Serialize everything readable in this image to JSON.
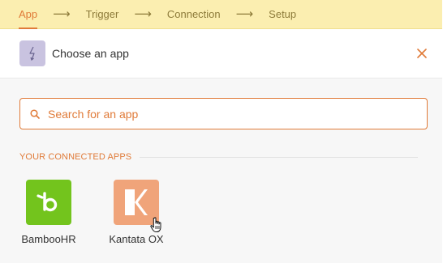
{
  "stepper": {
    "steps": [
      "App",
      "Trigger",
      "Connection",
      "Setup"
    ],
    "active_index": 0,
    "arrow": "⟶"
  },
  "header": {
    "title": "Choose an app",
    "icon": "lightning-icon",
    "close_icon": "close-icon"
  },
  "search": {
    "placeholder": "Search for an app",
    "value": "",
    "icon": "search-icon"
  },
  "section": {
    "label": "YOUR CONNECTED APPS"
  },
  "apps": [
    {
      "name": "BambooHR",
      "brand_color": "#73c41d",
      "logo": "bamboohr-logo"
    },
    {
      "name": "Kantata OX",
      "brand_color": "#f0a47a",
      "logo": "kantata-logo"
    }
  ],
  "colors": {
    "accent": "#e07b39",
    "stepper_bg": "#fbeeb0",
    "header_icon_bg": "#c9c3e0"
  }
}
